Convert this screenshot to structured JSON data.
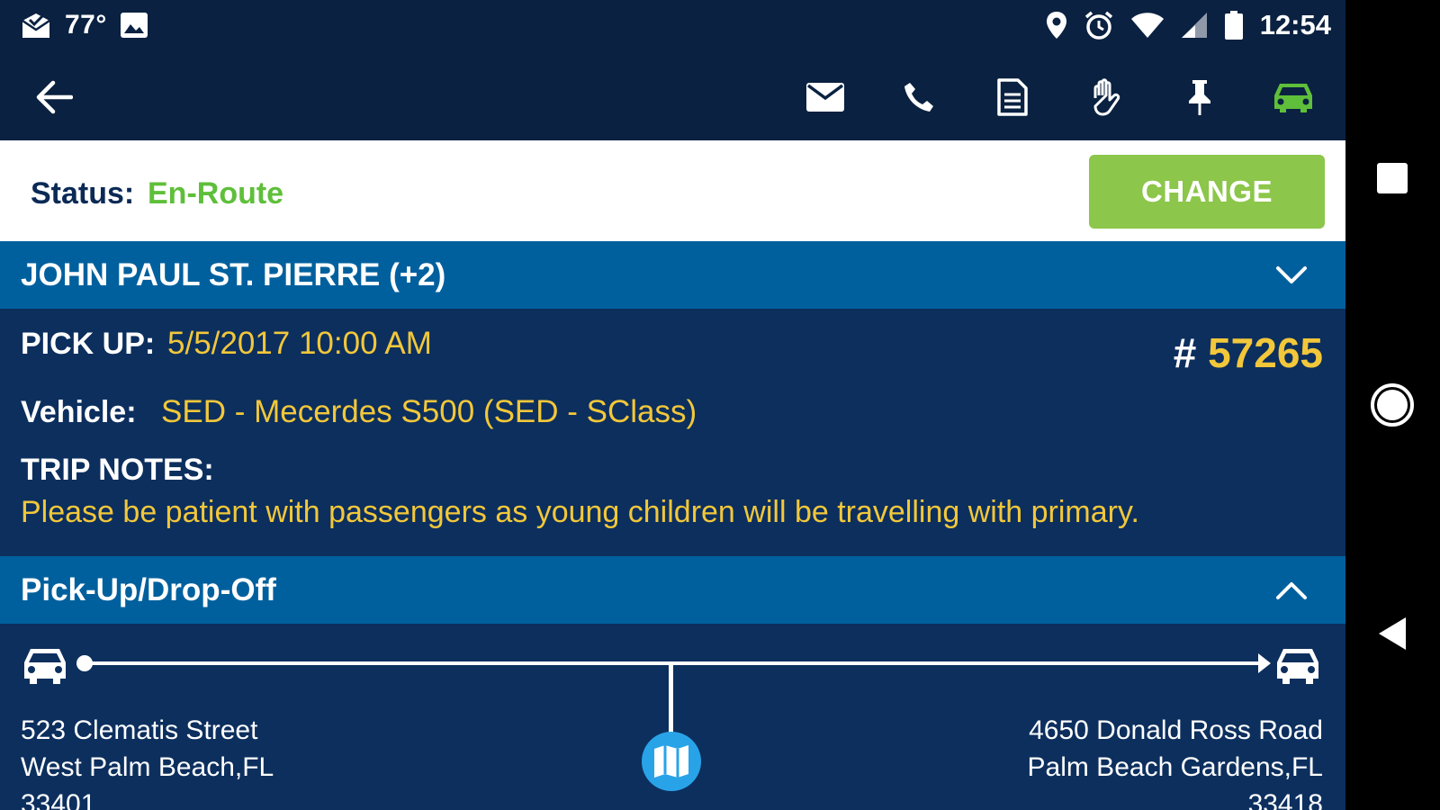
{
  "status_bar": {
    "temperature": "77°",
    "time": "12:54",
    "icons": [
      "mail-check-icon",
      "image-icon",
      "location-icon",
      "alarm-icon",
      "wifi-icon",
      "signal-icon",
      "battery-icon"
    ]
  },
  "toolbar": {
    "back_icon": "back-arrow-icon",
    "actions": [
      "email-icon",
      "phone-icon",
      "document-icon",
      "hand-icon",
      "pin-icon",
      "car-icon"
    ],
    "active_color": "#5fbf3a"
  },
  "status": {
    "label": "Status:",
    "value": "En-Route",
    "button": "CHANGE"
  },
  "passenger_section": {
    "title": "JOHN PAUL ST. PIERRE (+2)",
    "expand_icon": "chevron-down-icon"
  },
  "trip": {
    "pickup_label": "PICK UP:",
    "pickup_value": "5/5/2017 10:00 AM",
    "number_hash": "#",
    "number": "57265",
    "vehicle_label": "Vehicle:",
    "vehicle_value": "SED - Mecerdes S500 (SED - SClass)",
    "notes_label": "TRIP NOTES:",
    "notes_value": "Please be patient with passengers as young children will be travelling with primary."
  },
  "route_section": {
    "title": "Pick-Up/Drop-Off",
    "collapse_icon": "chevron-up-icon",
    "pickup": {
      "line1": "523 Clematis Street",
      "line2": "West Palm Beach,FL",
      "line3": "33401"
    },
    "dropoff": {
      "line1": "4650 Donald Ross Road",
      "line2": "Palm Beach Gardens,FL",
      "line3": "33418"
    },
    "map_icon": "map-icon"
  },
  "colors": {
    "toolbar_bg": "#0a2141",
    "panel_bg": "#0c2f5e",
    "section_bg": "#00609e",
    "accent_yellow": "#f2c73a",
    "accent_green": "#5fbf3a",
    "button_green": "#8cc64a"
  }
}
